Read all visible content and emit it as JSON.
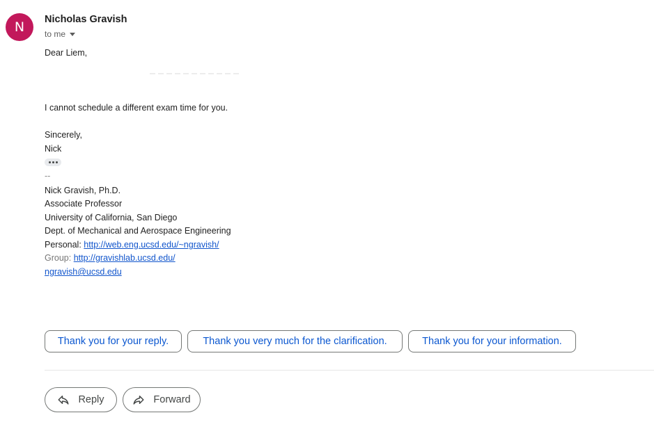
{
  "sender": {
    "avatar_letter": "N",
    "avatar_color": "#c2185b",
    "name": "Nicholas Gravish",
    "recipient": "to me"
  },
  "body": {
    "greeting": "Dear Liem,",
    "message": "I cannot schedule a different exam time for you.",
    "closing": "Sincerely,",
    "sign_name": "Nick"
  },
  "signature": {
    "dashes": "--",
    "name": "Nick Gravish, Ph.D.",
    "title": "Associate Professor",
    "university": "University of California, San Diego",
    "department": "Dept. of Mechanical and Aerospace Engineering",
    "personal_label": "Personal:",
    "personal_url": "http://web.eng.ucsd.edu/~ngravish/",
    "group_label": "Group:",
    "group_url": "http://gravishlab.ucsd.edu/",
    "email": "ngravish@ucsd.edu"
  },
  "smart_replies": [
    "Thank you for your reply.",
    "Thank you very much for the clarification.",
    "Thank you for your information."
  ],
  "actions": {
    "reply": "Reply",
    "forward": "Forward"
  },
  "icons": {
    "show_trimmed": "more-horiz-icon",
    "reply": "reply-icon",
    "forward": "forward-icon",
    "recipient_menu": "caret-down-icon"
  },
  "colors": {
    "link": "#1155cc",
    "chip_text": "#0b57d0"
  }
}
